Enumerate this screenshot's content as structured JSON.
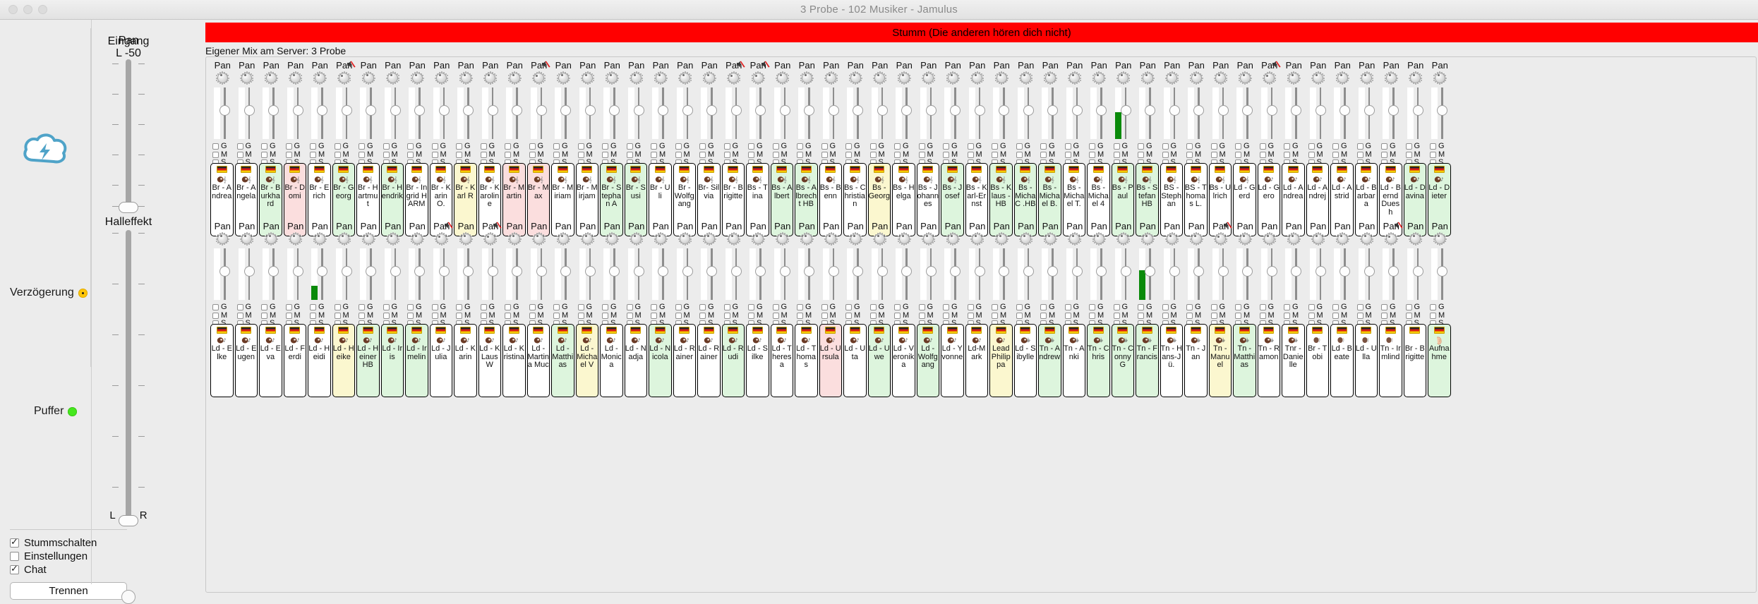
{
  "window": {
    "title": "3 Probe - 102 Musiker - Jamulus"
  },
  "left_panel": {
    "logo_name": "jamulus-cloud-logo",
    "delay_label": "Verzögerung",
    "delay_status_color": "#FFC60A",
    "buffer_label": "Puffer",
    "buffer_status_color": "#45E81D",
    "checkboxes": [
      {
        "label": "Stummschalten",
        "checked": true
      },
      {
        "label": "Einstellungen",
        "checked": false
      },
      {
        "label": "Chat",
        "checked": true
      }
    ],
    "disconnect_button": "Trennen"
  },
  "input_column": {
    "header": "Eingang"
  },
  "master": {
    "pan_label": "Pan",
    "pan_value": "L -50",
    "reverb_label": "Halleffekt",
    "left_label": "L",
    "right_label": "R"
  },
  "mute_banner": {
    "text": "Stumm (Die anderen hören dich nicht)",
    "color": "#FF0000"
  },
  "own_mix": {
    "text": "Eigener Mix am Server: 3 Probe"
  },
  "channel_defaults": {
    "pan_label": "Pan",
    "gain_label": "G",
    "mute_label": "M",
    "solo_label": "S",
    "flag": "de-flag-icon"
  },
  "rows": [
    {
      "id": "row-1",
      "channels": [
        {
          "name": "Br - Andrea",
          "bg": "white",
          "instr": "singer",
          "muted": false,
          "pan": 0.35,
          "level": 0
        },
        {
          "name": "Br - Angela",
          "bg": "white",
          "instr": "singer",
          "muted": false,
          "pan": 0.35,
          "level": 0
        },
        {
          "name": "Br - Burkhard",
          "bg": "green",
          "instr": "singer",
          "muted": false,
          "pan": 0.35,
          "level": 0
        },
        {
          "name": "Br - Domi",
          "bg": "pink",
          "instr": "singer",
          "muted": false,
          "pan": 0.35,
          "level": 0
        },
        {
          "name": "Br - Erich",
          "bg": "white",
          "instr": "singer",
          "muted": false,
          "pan": 0.35,
          "level": 0
        },
        {
          "name": "Br - Georg",
          "bg": "green",
          "instr": "singer",
          "muted": true,
          "pan": 0.2,
          "level": 0
        },
        {
          "name": "Br - Hartmut",
          "bg": "white",
          "instr": "singer",
          "muted": false,
          "pan": 0.35,
          "level": 0
        },
        {
          "name": "Br - Hendrik",
          "bg": "green",
          "instr": "singer",
          "muted": false,
          "pan": 0.35,
          "level": 0
        },
        {
          "name": "Br - Ingrid HARM",
          "bg": "white",
          "instr": "singer",
          "muted": false,
          "pan": 0.35,
          "level": 0
        },
        {
          "name": "Br - Karin O.",
          "bg": "white",
          "instr": "singer",
          "muted": false,
          "pan": 0.35,
          "level": 0
        },
        {
          "name": "Br - Karl R",
          "bg": "yellow",
          "instr": "singer",
          "muted": false,
          "pan": 0.35,
          "level": 0
        },
        {
          "name": "Br - Karoline",
          "bg": "white",
          "instr": "singer",
          "muted": false,
          "pan": 0.35,
          "level": 0
        },
        {
          "name": "Br - Martin",
          "bg": "pink",
          "instr": "singer",
          "muted": false,
          "pan": 0.35,
          "level": 0
        },
        {
          "name": "Br - Max",
          "bg": "pink",
          "instr": "singer",
          "muted": true,
          "pan": 0.2,
          "level": 0
        },
        {
          "name": "Br - Miriam",
          "bg": "white",
          "instr": "singer",
          "muted": false,
          "pan": 0.35,
          "level": 0
        },
        {
          "name": "Br - Mirjam",
          "bg": "white",
          "instr": "singer",
          "muted": false,
          "pan": 0.35,
          "level": 0
        },
        {
          "name": "Br - Stephan A",
          "bg": "green",
          "instr": "singer",
          "muted": false,
          "pan": 0.35,
          "level": 0
        },
        {
          "name": "Br - Susi",
          "bg": "green",
          "instr": "singer",
          "muted": false,
          "pan": 0.35,
          "level": 0
        },
        {
          "name": "Br - Uli",
          "bg": "white",
          "instr": "singer",
          "muted": false,
          "pan": 0.35,
          "level": 0
        },
        {
          "name": "Br - Wolfgang",
          "bg": "white",
          "instr": "singer",
          "muted": false,
          "pan": 0.35,
          "level": 0
        },
        {
          "name": "Br- Silvia",
          "bg": "white",
          "instr": "singer",
          "muted": false,
          "pan": 0.35,
          "level": 0
        },
        {
          "name": "Br - Brigitte",
          "bg": "white",
          "instr": "singer",
          "muted": true,
          "pan": 0.2,
          "level": 0
        },
        {
          "name": "Bs - Tina",
          "bg": "white",
          "instr": "bass-singer",
          "muted": true,
          "pan": 0.2,
          "level": 0
        },
        {
          "name": "Bs - Albert",
          "bg": "green",
          "instr": "bass-singer",
          "muted": false,
          "pan": 0.35,
          "level": 0
        },
        {
          "name": "Bs - Albrecht HB",
          "bg": "green",
          "instr": "bass-singer",
          "muted": false,
          "pan": 0.35,
          "level": 0
        },
        {
          "name": "Bs - Benn",
          "bg": "white",
          "instr": "bass-singer",
          "muted": false,
          "pan": 0.35,
          "level": 0
        },
        {
          "name": "Bs - Christian",
          "bg": "white",
          "instr": "bass-singer",
          "muted": false,
          "pan": 0.35,
          "level": 0
        },
        {
          "name": "Bs - Georg",
          "bg": "yellow",
          "instr": "bass-singer",
          "muted": false,
          "pan": 0.35,
          "level": 0
        },
        {
          "name": "Bs - Helga",
          "bg": "white",
          "instr": "bass-singer",
          "muted": false,
          "pan": 0.35,
          "level": 0
        },
        {
          "name": "Bs - Johannes",
          "bg": "white",
          "instr": "bass-singer",
          "muted": false,
          "pan": 0.35,
          "level": 0
        },
        {
          "name": "Bs - Josef",
          "bg": "green",
          "instr": "bass-singer",
          "muted": false,
          "pan": 0.35,
          "level": 0
        },
        {
          "name": "Bs - Karl-Ernst",
          "bg": "white",
          "instr": "bass-singer",
          "muted": false,
          "pan": 0.35,
          "level": 0
        },
        {
          "name": "Bs - Klaus - HB",
          "bg": "green",
          "instr": "bass-singer",
          "muted": false,
          "pan": 0.35,
          "level": 0
        },
        {
          "name": "Bs - Micha C .HB",
          "bg": "green",
          "instr": "bass-singer",
          "muted": false,
          "pan": 0.35,
          "level": 0
        },
        {
          "name": "Bs - Michael B.",
          "bg": "green",
          "instr": "bass-singer",
          "muted": false,
          "pan": 0.35,
          "level": 0
        },
        {
          "name": "Bs - Michael T.",
          "bg": "white",
          "instr": "bass-singer",
          "muted": false,
          "pan": 0.35,
          "level": 0
        },
        {
          "name": "Bs - Michael 4",
          "bg": "white",
          "instr": "bass-singer",
          "muted": false,
          "pan": 0.35,
          "level": 0
        },
        {
          "name": "Bs - Paul",
          "bg": "green",
          "instr": "bass-singer",
          "muted": false,
          "pan": 0.35,
          "level": 0.52
        },
        {
          "name": "Bs - Stefan HB",
          "bg": "green",
          "instr": "bass-singer",
          "muted": false,
          "pan": 0.35,
          "level": 0
        },
        {
          "name": "BS - Stephan",
          "bg": "white",
          "instr": "bass-singer",
          "muted": false,
          "pan": 0.35,
          "level": 0
        },
        {
          "name": "BS - Thomas L.",
          "bg": "white",
          "instr": "bass-singer",
          "muted": false,
          "pan": 0.35,
          "level": 0
        },
        {
          "name": "Bs - Ulrich",
          "bg": "white",
          "instr": "bass-singer",
          "muted": false,
          "pan": 0.35,
          "level": 0
        },
        {
          "name": "Ld - Gerd",
          "bg": "white",
          "instr": "bass-singer",
          "muted": false,
          "pan": 0.35,
          "level": 0
        },
        {
          "name": "Ld - Gero",
          "bg": "white",
          "instr": "lead-singer",
          "muted": true,
          "pan": 0.2,
          "level": 0
        },
        {
          "name": "Ld - Andrea",
          "bg": "white",
          "instr": "lead-singer",
          "muted": false,
          "pan": 0.35,
          "level": 0
        },
        {
          "name": "Ld - Andrej",
          "bg": "white",
          "instr": "lead-singer",
          "muted": false,
          "pan": 0.35,
          "level": 0
        },
        {
          "name": "Ld - Astrid",
          "bg": "white",
          "instr": "lead-singer",
          "muted": false,
          "pan": 0.35,
          "level": 0
        },
        {
          "name": "Ld - Barbara",
          "bg": "white",
          "instr": "lead-singer",
          "muted": false,
          "pan": 0.35,
          "level": 0
        },
        {
          "name": "Ld - Bernd Duesh",
          "bg": "white",
          "instr": "lead-singer",
          "muted": false,
          "pan": 0.35,
          "level": 0
        },
        {
          "name": "Ld - Davina",
          "bg": "green",
          "instr": "lead-singer",
          "muted": false,
          "pan": 0.35,
          "level": 0
        },
        {
          "name": "Ld - Dieter",
          "bg": "green",
          "instr": "lead-singer",
          "muted": false,
          "pan": 0.35,
          "level": 0
        }
      ]
    },
    {
      "id": "row-2",
      "channels": [
        {
          "name": "Ld - Elke",
          "bg": "white",
          "instr": "lead-singer",
          "muted": false,
          "pan": 0.35,
          "level": 0
        },
        {
          "name": "Ld - Eugen",
          "bg": "white",
          "instr": "lead-singer",
          "muted": false,
          "pan": 0.35,
          "level": 0
        },
        {
          "name": "Ld - Eva",
          "bg": "white",
          "instr": "lead-singer",
          "muted": false,
          "pan": 0.35,
          "level": 0
        },
        {
          "name": "Ld - Ferdi",
          "bg": "white",
          "instr": "lead-singer",
          "muted": false,
          "pan": 0.35,
          "level": 0
        },
        {
          "name": "Ld - Heidi",
          "bg": "white",
          "instr": "lead-singer",
          "muted": false,
          "pan": 0.35,
          "level": 0.28
        },
        {
          "name": "Ld - Heike",
          "bg": "yellow",
          "instr": "lead-singer",
          "muted": false,
          "pan": 0.35,
          "level": 0
        },
        {
          "name": "Ld - Heiner HB",
          "bg": "green",
          "instr": "lead-singer",
          "muted": false,
          "pan": 0.35,
          "level": 0
        },
        {
          "name": "Ld - Iris",
          "bg": "green",
          "instr": "lead-singer",
          "muted": false,
          "pan": 0.35,
          "level": 0
        },
        {
          "name": "Ld - Irmelin",
          "bg": "green",
          "instr": "lead-singer",
          "muted": false,
          "pan": 0.35,
          "level": 0
        },
        {
          "name": "Ld - Julia",
          "bg": "white",
          "instr": "lead-singer",
          "muted": true,
          "pan": 0.2,
          "level": 0
        },
        {
          "name": "Ld - Karin",
          "bg": "white",
          "instr": "lead-singer",
          "muted": false,
          "pan": 0.35,
          "level": 0
        },
        {
          "name": "Ld - KLausW",
          "bg": "white",
          "instr": "lead-singer",
          "muted": true,
          "pan": 0.2,
          "level": 0
        },
        {
          "name": "Ld - Kristina",
          "bg": "white",
          "instr": "lead-singer",
          "muted": false,
          "pan": 0.35,
          "level": 0
        },
        {
          "name": "Ld - Martina Muc",
          "bg": "white",
          "instr": "lead-singer",
          "muted": false,
          "pan": 0.35,
          "level": 0
        },
        {
          "name": "Ld - Matthias",
          "bg": "green",
          "instr": "lead-singer",
          "muted": false,
          "pan": 0.35,
          "level": 0
        },
        {
          "name": "Ld - Michael V",
          "bg": "yellow",
          "instr": "lead-singer",
          "muted": false,
          "pan": 0.35,
          "level": 0
        },
        {
          "name": "Ld - Monica",
          "bg": "white",
          "instr": "lead-singer",
          "muted": false,
          "pan": 0.35,
          "level": 0
        },
        {
          "name": "Ld - Nadja",
          "bg": "white",
          "instr": "lead-singer",
          "muted": false,
          "pan": 0.35,
          "level": 0
        },
        {
          "name": "Ld - Nicola",
          "bg": "green",
          "instr": "lead-singer",
          "muted": false,
          "pan": 0.35,
          "level": 0
        },
        {
          "name": "Ld - Rainer",
          "bg": "white",
          "instr": "lead-singer",
          "muted": false,
          "pan": 0.35,
          "level": 0
        },
        {
          "name": "Ld - Rainer",
          "bg": "white",
          "instr": "lead-singer",
          "muted": false,
          "pan": 0.35,
          "level": 0
        },
        {
          "name": "Ld - Rudi",
          "bg": "green",
          "instr": "lead-singer",
          "muted": false,
          "pan": 0.35,
          "level": 0
        },
        {
          "name": "Ld - Silke",
          "bg": "white",
          "instr": "lead-singer",
          "muted": false,
          "pan": 0.35,
          "level": 0
        },
        {
          "name": "Ld - Theresa",
          "bg": "white",
          "instr": "lead-singer",
          "muted": false,
          "pan": 0.35,
          "level": 0
        },
        {
          "name": "Ld - Thomas",
          "bg": "white",
          "instr": "lead-singer",
          "muted": false,
          "pan": 0.35,
          "level": 0
        },
        {
          "name": "Ld - Ursula",
          "bg": "pink",
          "instr": "lead-singer",
          "muted": false,
          "pan": 0.35,
          "level": 0
        },
        {
          "name": "Ld - Uta",
          "bg": "white",
          "instr": "lead-singer",
          "muted": false,
          "pan": 0.35,
          "level": 0
        },
        {
          "name": "Ld - Uwe",
          "bg": "green",
          "instr": "lead-singer",
          "muted": false,
          "pan": 0.35,
          "level": 0
        },
        {
          "name": "Ld - Veronika",
          "bg": "white",
          "instr": "lead-singer",
          "muted": false,
          "pan": 0.35,
          "level": 0
        },
        {
          "name": "Ld - Wolfgang",
          "bg": "green",
          "instr": "lead-singer",
          "muted": false,
          "pan": 0.35,
          "level": 0
        },
        {
          "name": "Ld - Yvonne",
          "bg": "white",
          "instr": "lead-singer",
          "muted": false,
          "pan": 0.35,
          "level": 0
        },
        {
          "name": "Ld-Mark",
          "bg": "white",
          "instr": "lead-singer",
          "muted": false,
          "pan": 0.35,
          "level": 0
        },
        {
          "name": "Lead Philippa",
          "bg": "yellow",
          "instr": "lead-singer",
          "muted": false,
          "pan": 0.35,
          "level": 0
        },
        {
          "name": "Ld - Sibylle",
          "bg": "white",
          "instr": "tenor-singer",
          "muted": false,
          "pan": 0.35,
          "level": 0
        },
        {
          "name": "Tn - Andrew",
          "bg": "green",
          "instr": "tenor-singer",
          "muted": false,
          "pan": 0.35,
          "level": 0
        },
        {
          "name": "Tn - Anki",
          "bg": "white",
          "instr": "tenor-singer",
          "muted": false,
          "pan": 0.35,
          "level": 0
        },
        {
          "name": "Tn - Chris",
          "bg": "green",
          "instr": "tenor-singer",
          "muted": false,
          "pan": 0.35,
          "level": 0
        },
        {
          "name": "Tn - ConnyG",
          "bg": "green",
          "instr": "tenor-singer",
          "muted": false,
          "pan": 0.35,
          "level": 0
        },
        {
          "name": "Tn - Francis",
          "bg": "green",
          "instr": "tenor-singer",
          "muted": false,
          "pan": 0.35,
          "level": 0.58
        },
        {
          "name": "Tn - Hans-Jü.",
          "bg": "white",
          "instr": "tenor-singer",
          "muted": false,
          "pan": 0.35,
          "level": 0
        },
        {
          "name": "Tn - Jan",
          "bg": "white",
          "instr": "tenor-singer",
          "muted": false,
          "pan": 0.35,
          "level": 0
        },
        {
          "name": "Tn - Manuel",
          "bg": "yellow",
          "instr": "tenor-singer",
          "muted": true,
          "pan": 0.2,
          "level": 0
        },
        {
          "name": "Tn - Matthias",
          "bg": "green",
          "instr": "tenor-singer",
          "muted": false,
          "pan": 0.35,
          "level": 0
        },
        {
          "name": "Tn - Ramon",
          "bg": "white",
          "instr": "tenor-singer",
          "muted": false,
          "pan": 0.35,
          "level": 0
        },
        {
          "name": "Tnr - Danielle",
          "bg": "white",
          "instr": "tenor-singer",
          "muted": false,
          "pan": 0.35,
          "level": 0
        },
        {
          "name": "Br - Tobi",
          "bg": "white",
          "instr": "speaker",
          "muted": false,
          "pan": 0.35,
          "level": 0
        },
        {
          "name": "Ld - Beate",
          "bg": "white",
          "instr": "speaker",
          "muted": false,
          "pan": 0.35,
          "level": 0
        },
        {
          "name": "Ld - Ulla",
          "bg": "white",
          "instr": "speaker",
          "muted": false,
          "pan": 0.35,
          "level": 0
        },
        {
          "name": "Tn - Irmlind",
          "bg": "white",
          "instr": "speaker",
          "muted": true,
          "pan": 0.2,
          "level": 0
        },
        {
          "name": "Br - Brigitte",
          "bg": "white",
          "instr": "none",
          "muted": false,
          "pan": 0.35,
          "level": 0
        },
        {
          "name": "Aufnahme",
          "bg": "green",
          "instr": "listener",
          "muted": false,
          "pan": 0.35,
          "level": 0
        }
      ]
    }
  ]
}
